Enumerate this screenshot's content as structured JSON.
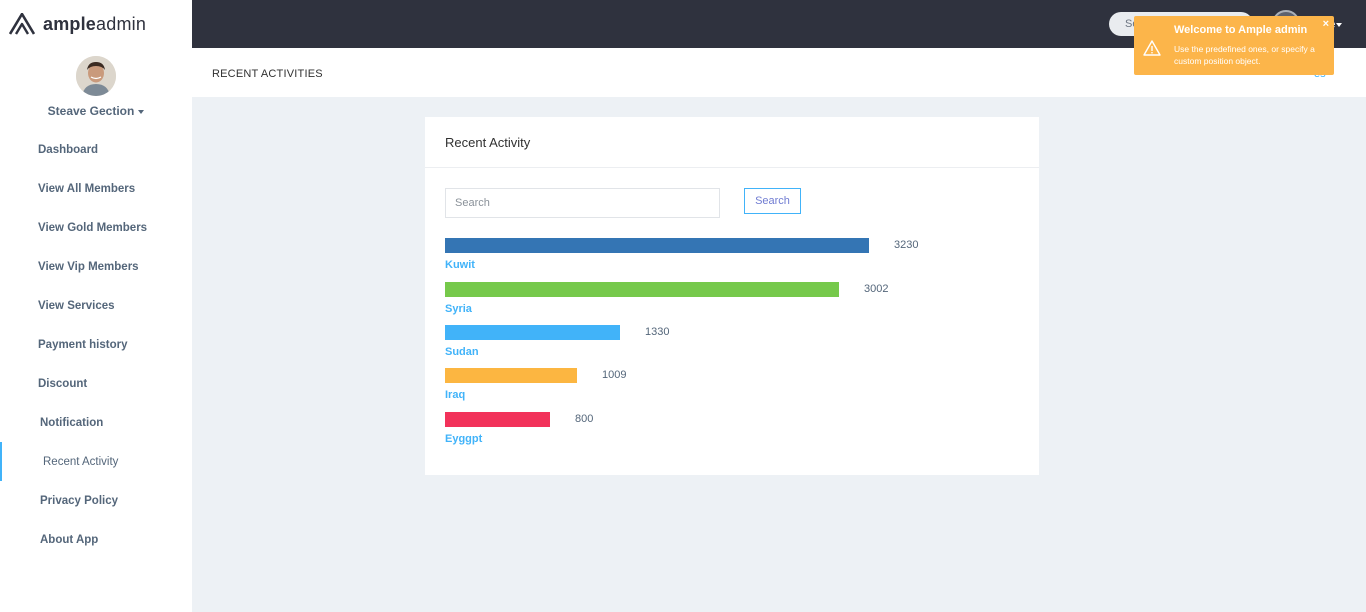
{
  "brand": {
    "bold": "ample",
    "light": "admin"
  },
  "user": {
    "name": "Steave Gection"
  },
  "topbar": {
    "search_placeholder": "Se",
    "user_label": "ve"
  },
  "nav": [
    {
      "label": "Dashboard"
    },
    {
      "label": "View All Members"
    },
    {
      "label": "View Gold Members"
    },
    {
      "label": "View Vip Members"
    },
    {
      "label": "View Services"
    },
    {
      "label": "Payment history"
    },
    {
      "label": "Discount"
    },
    {
      "label": "Notification"
    },
    {
      "label": "Recent Activity"
    },
    {
      "label": "Privacy Policy"
    },
    {
      "label": "About App"
    }
  ],
  "page": {
    "title": "RECENT ACTIVITIES",
    "crumb": "es"
  },
  "toast": {
    "title": "Welcome to Ample admin",
    "text": "Use the predefined ones, or specify a custom position object.",
    "close": "×"
  },
  "card": {
    "title": "Recent Activity",
    "search_placeholder": "Search",
    "search_button": "Search"
  },
  "chart_data": {
    "type": "bar",
    "categories": [
      "Kuwit",
      "Syria",
      "Sudan",
      "Iraq",
      "Eyggpt"
    ],
    "values": [
      3230,
      3002,
      1330,
      1009,
      800
    ],
    "colors": [
      "#3475b4",
      "#76c94b",
      "#41b3f9",
      "#fcb641",
      "#f2325a"
    ]
  }
}
